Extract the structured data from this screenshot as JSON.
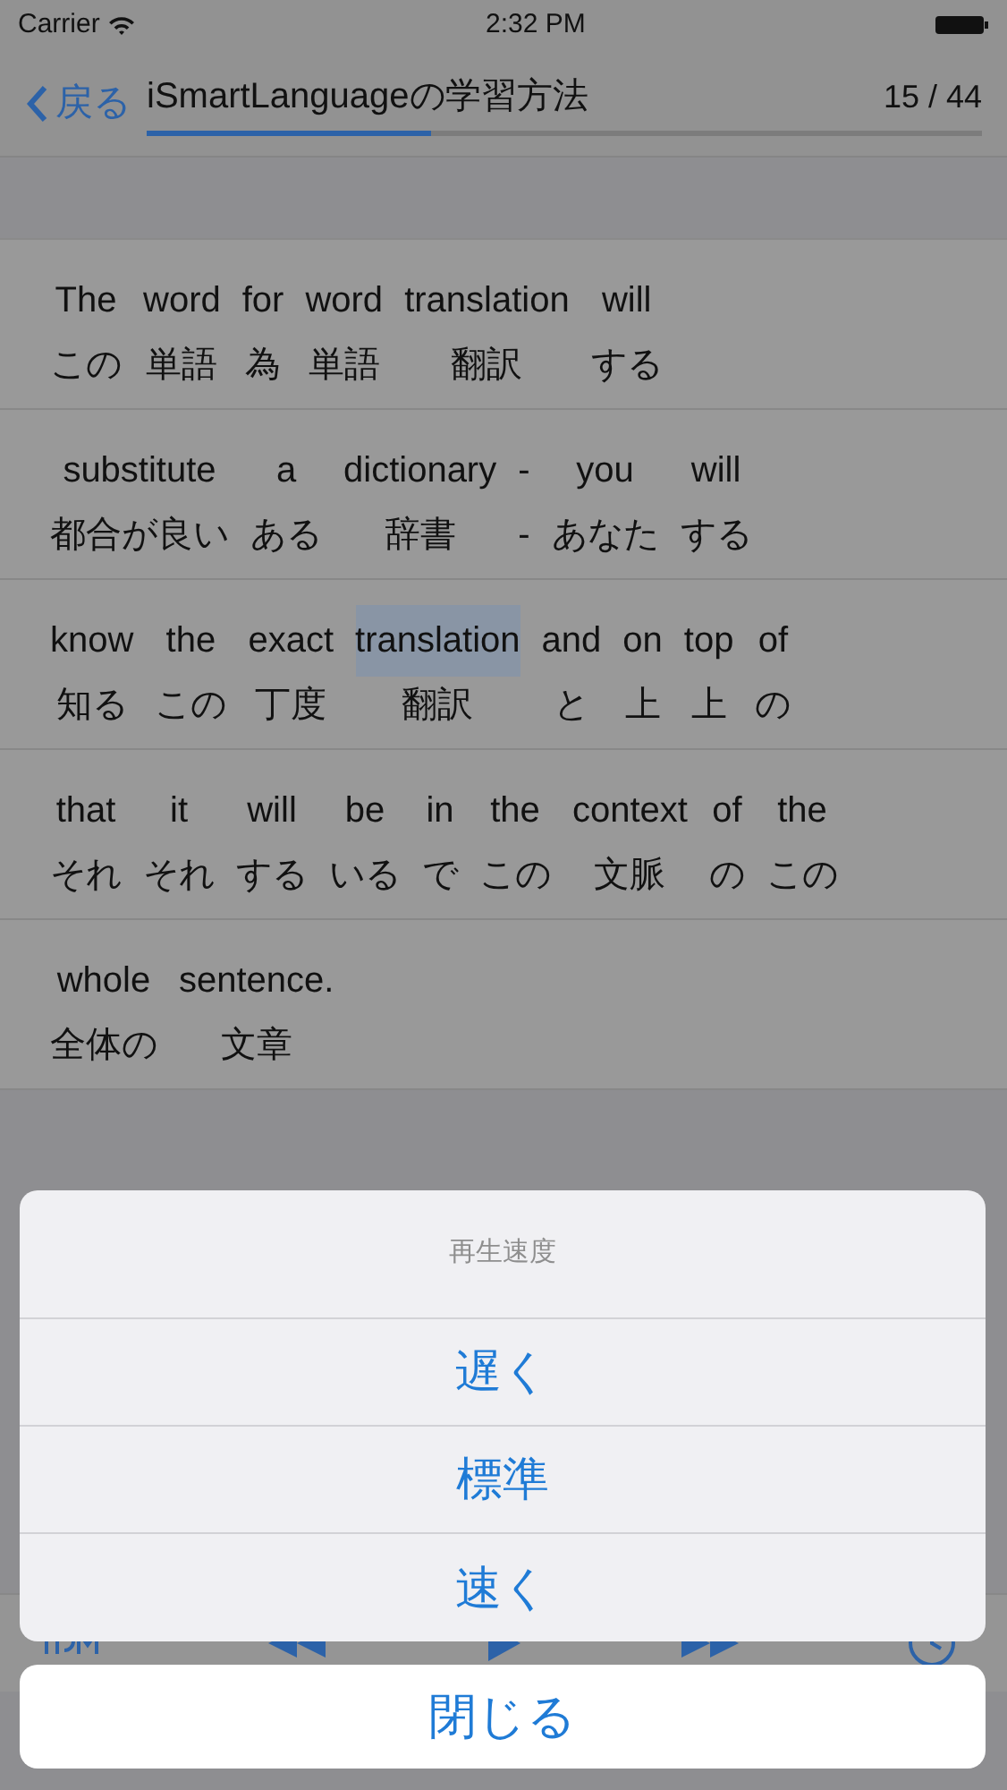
{
  "status_bar": {
    "carrier": "Carrier",
    "time": "2:32 PM"
  },
  "nav": {
    "back": "戻る",
    "title": "iSmartLanguageの学習方法",
    "counter": "15 / 44",
    "level": 0.34
  },
  "rows": [
    {
      "words": [
        {
          "en": "The",
          "ja": "この",
          "selected": false
        },
        {
          "en": "word",
          "ja": "単語",
          "selected": false
        },
        {
          "en": "for",
          "ja": "為",
          "selected": false
        },
        {
          "en": "word",
          "ja": "単語",
          "selected": false
        },
        {
          "en": "translation",
          "ja": "翻訳",
          "selected": false
        },
        {
          "en": "will",
          "ja": "する",
          "selected": false
        }
      ]
    },
    {
      "words": [
        {
          "en": "substitute",
          "ja": "都合が良い",
          "selected": false
        },
        {
          "en": "a",
          "ja": "ある",
          "selected": false
        },
        {
          "en": "dictionary",
          "ja": "辞書",
          "selected": false
        },
        {
          "en": "-",
          "ja": "-",
          "selected": false
        },
        {
          "en": "you",
          "ja": "あなた",
          "selected": false
        },
        {
          "en": "will",
          "ja": "する",
          "selected": false
        }
      ]
    },
    {
      "words": [
        {
          "en": "know",
          "ja": "知る",
          "selected": false
        },
        {
          "en": "the",
          "ja": "この",
          "selected": false
        },
        {
          "en": "exact",
          "ja": "丁度",
          "selected": false
        },
        {
          "en": "translation",
          "ja": "翻訳",
          "selected": true
        },
        {
          "en": "and",
          "ja": "と",
          "selected": false
        },
        {
          "en": "on",
          "ja": "上",
          "selected": false
        },
        {
          "en": "top",
          "ja": "上",
          "selected": false
        },
        {
          "en": "of",
          "ja": "の",
          "selected": false
        }
      ]
    },
    {
      "words": [
        {
          "en": "that",
          "ja": "それ",
          "selected": false
        },
        {
          "en": "it",
          "ja": "それ",
          "selected": false
        },
        {
          "en": "will",
          "ja": "する",
          "selected": false
        },
        {
          "en": "be",
          "ja": "いる",
          "selected": false
        },
        {
          "en": "in",
          "ja": "で",
          "selected": false
        },
        {
          "en": "the",
          "ja": "この",
          "selected": false
        },
        {
          "en": "context",
          "ja": "文脈",
          "selected": false
        },
        {
          "en": "of",
          "ja": "の",
          "selected": false
        },
        {
          "en": "the",
          "ja": "この",
          "selected": false
        }
      ]
    },
    {
      "words": [
        {
          "en": "whole",
          "ja": "全体の",
          "selected": false
        },
        {
          "en": "sentence.",
          "ja": "文章",
          "selected": false
        }
      ]
    }
  ],
  "action_sheet": {
    "title": "再生速度",
    "options": [
      "遅く",
      "標準",
      "速く"
    ],
    "cancel": "閉じる"
  }
}
